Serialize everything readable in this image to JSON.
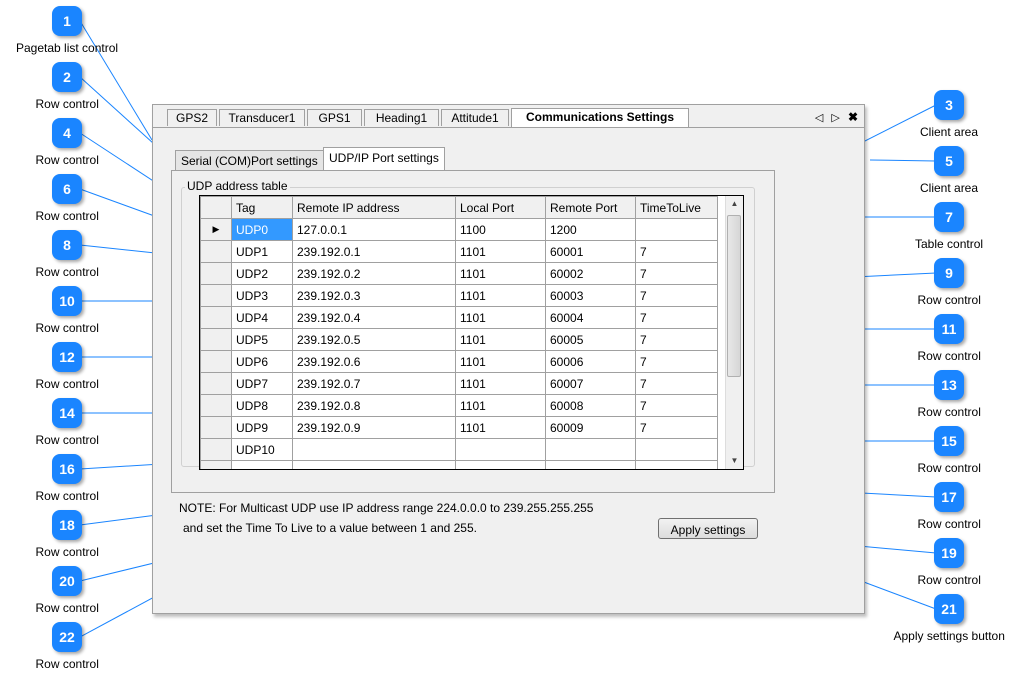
{
  "page_tabs": [
    "GPS2",
    "Transducer1",
    "GPS1",
    "Heading1",
    "Attitude1",
    "Communications Settings"
  ],
  "active_page_tab": "Communications Settings",
  "tab_nav": {
    "left": "◁",
    "right": "▷",
    "close": "✖"
  },
  "sub_tabs": [
    "Serial (COM)Port settings",
    "UDP/IP Port settings"
  ],
  "active_sub_tab": "UDP/IP Port settings",
  "group_label": "UDP address table",
  "table": {
    "columns": [
      "Tag",
      "Remote IP address",
      "Local Port",
      "Remote Port",
      "TimeToLive"
    ],
    "rows": [
      [
        "UDP0",
        "127.0.0.1",
        "1100",
        "1200",
        ""
      ],
      [
        "UDP1",
        "239.192.0.1",
        "1101",
        "60001",
        "7"
      ],
      [
        "UDP2",
        "239.192.0.2",
        "1101",
        "60002",
        "7"
      ],
      [
        "UDP3",
        "239.192.0.3",
        "1101",
        "60003",
        "7"
      ],
      [
        "UDP4",
        "239.192.0.4",
        "1101",
        "60004",
        "7"
      ],
      [
        "UDP5",
        "239.192.0.5",
        "1101",
        "60005",
        "7"
      ],
      [
        "UDP6",
        "239.192.0.6",
        "1101",
        "60006",
        "7"
      ],
      [
        "UDP7",
        "239.192.0.7",
        "1101",
        "60007",
        "7"
      ],
      [
        "UDP8",
        "239.192.0.8",
        "1101",
        "60008",
        "7"
      ],
      [
        "UDP9",
        "239.192.0.9",
        "1101",
        "60009",
        "7"
      ],
      [
        "UDP10",
        "",
        "",
        "",
        ""
      ],
      [
        "",
        "",
        "",
        "",
        ""
      ]
    ],
    "current_row_marker": "▶"
  },
  "note_line1": "NOTE: For Multicast UDP use IP address range 224.0.0.0 to 239.255.255.255",
  "note_line2": "and set the Time To Live to a value between 1 and 255.",
  "apply_button": "Apply settings",
  "callouts": [
    {
      "n": "1",
      "label": "Pagetab list control"
    },
    {
      "n": "2",
      "label": "Row control"
    },
    {
      "n": "3",
      "label": "Client area"
    },
    {
      "n": "4",
      "label": "Row control"
    },
    {
      "n": "5",
      "label": "Client area"
    },
    {
      "n": "6",
      "label": "Row control"
    },
    {
      "n": "7",
      "label": "Table control"
    },
    {
      "n": "8",
      "label": "Row control"
    },
    {
      "n": "9",
      "label": "Row control"
    },
    {
      "n": "10",
      "label": "Row control"
    },
    {
      "n": "11",
      "label": "Row control"
    },
    {
      "n": "12",
      "label": "Row control"
    },
    {
      "n": "13",
      "label": "Row control"
    },
    {
      "n": "14",
      "label": "Row control"
    },
    {
      "n": "15",
      "label": "Row control"
    },
    {
      "n": "16",
      "label": "Row control"
    },
    {
      "n": "17",
      "label": "Row control"
    },
    {
      "n": "18",
      "label": "Row control"
    },
    {
      "n": "19",
      "label": "Row control"
    },
    {
      "n": "20",
      "label": "Row control"
    },
    {
      "n": "21",
      "label": "Apply settings button"
    },
    {
      "n": "22",
      "label": "Row control"
    }
  ]
}
